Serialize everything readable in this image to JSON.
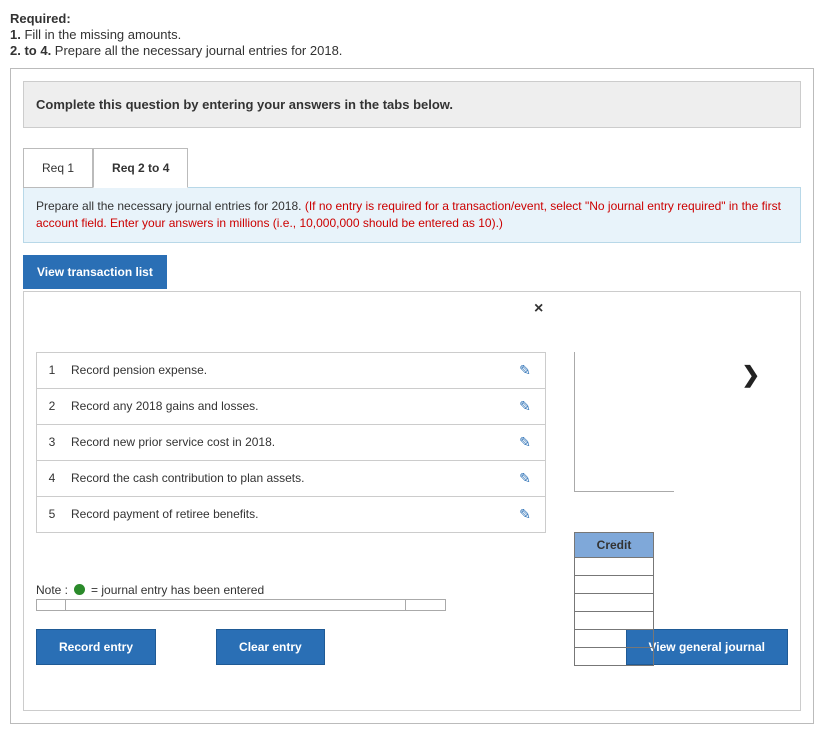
{
  "required": {
    "title": "Required:",
    "line1_bold": "1.",
    "line1_text": " Fill in the missing amounts.",
    "line2_bold": "2. to 4.",
    "line2_text": " Prepare all the necessary journal entries for 2018."
  },
  "banner": "Complete this question by entering your answers in the tabs below.",
  "tabs": {
    "req1": "Req 1",
    "req2to4": "Req 2 to 4"
  },
  "instruction": {
    "black": "Prepare all the necessary journal entries for 2018. ",
    "red": "(If no entry is required for a transaction/event, select \"No journal entry required\" in the first account field. Enter your answers in millions (i.e., 10,000,000 should be entered as 10).)"
  },
  "view_transaction_list": "View transaction list",
  "close_symbol": "×",
  "chevron": "❯",
  "transactions": [
    {
      "num": "1",
      "desc": "Record pension expense."
    },
    {
      "num": "2",
      "desc": "Record any 2018 gains and losses."
    },
    {
      "num": "3",
      "desc": "Record new prior service cost in 2018."
    },
    {
      "num": "4",
      "desc": "Record the cash contribution to plan assets."
    },
    {
      "num": "5",
      "desc": "Record payment of retiree benefits."
    }
  ],
  "credit_label": "Credit",
  "note_prefix": "Note : ",
  "note_text": " = journal entry has been entered",
  "buttons": {
    "record": "Record entry",
    "clear": "Clear entry",
    "view_gj": "View general journal"
  }
}
